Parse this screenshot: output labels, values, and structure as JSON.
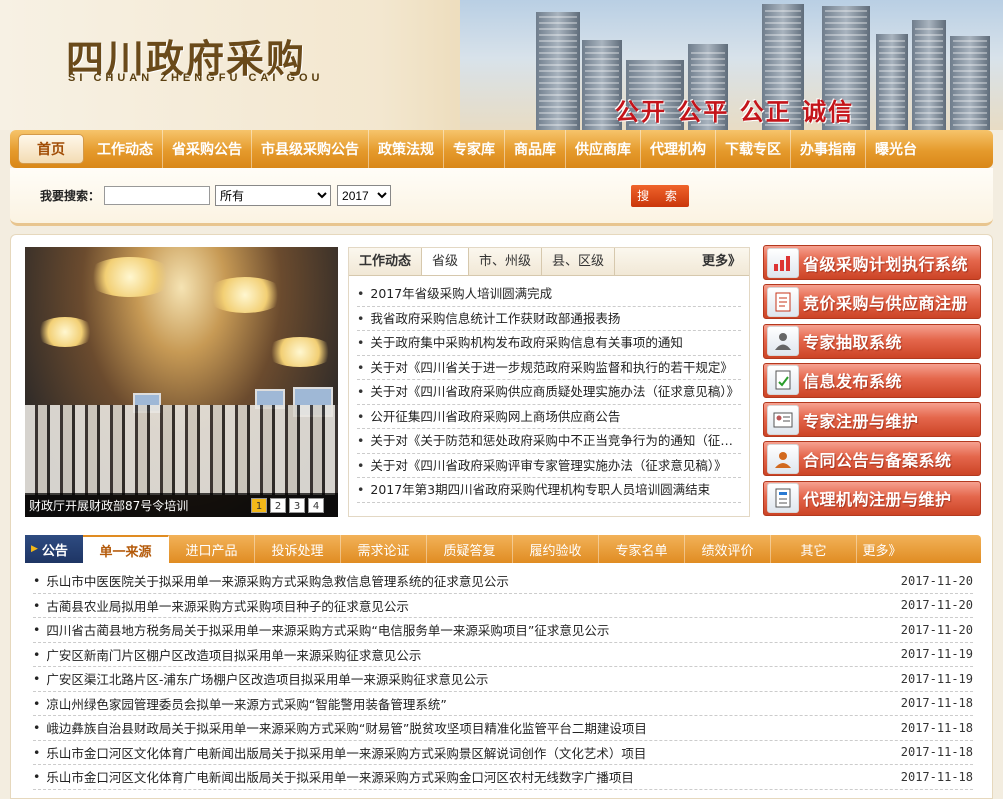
{
  "header": {
    "title_cn": "四川政府采购",
    "title_en": "SI CHUAN ZHENGFU CAI GOU",
    "slogan": "公开 公平 公正 诚信"
  },
  "nav": {
    "items": [
      "首页",
      "工作动态",
      "省采购公告",
      "市县级采购公告",
      "政策法规",
      "专家库",
      "商品库",
      "供应商库",
      "代理机构",
      "下载专区",
      "办事指南",
      "曝光台"
    ]
  },
  "search": {
    "label": "我要搜索：",
    "keyword_value": "",
    "category_selected": "所有",
    "year_selected": "2017",
    "button_label": "搜 索"
  },
  "slideshow": {
    "caption": "财政厅开展财政部87号令培训",
    "pages": [
      "1",
      "2",
      "3",
      "4"
    ],
    "active_page": "1"
  },
  "news": {
    "title": "工作动态",
    "tabs": [
      "省级",
      "市、州级",
      "县、区级"
    ],
    "more": "更多》",
    "items": [
      "2017年省级采购人培训圆满完成",
      "我省政府采购信息统计工作获财政部通报表扬",
      "关于政府集中采购机构发布政府采购信息有关事项的通知",
      "关于对《四川省关于进一步规范政府采购监督和执行的若干规定》",
      "关于对《四川省政府采购供应商质疑处理实施办法（征求意见稿）》",
      "公开征集四川省政府采购网上商场供应商公告",
      "关于对《关于防范和惩处政府采购中不正当竞争行为的通知（征求意见稿）》",
      "关于对《四川省政府采购评审专家管理实施办法（征求意见稿）》",
      "2017年第3期四川省政府采购代理机构专职人员培训圆满结束"
    ]
  },
  "systems": {
    "items": [
      {
        "label": "省级采购计划执行系统",
        "icon": "chart-icon"
      },
      {
        "label": "竞价采购与供应商注册",
        "icon": "document-icon"
      },
      {
        "label": "专家抽取系统",
        "icon": "person-icon"
      },
      {
        "label": "信息发布系统",
        "icon": "checklist-icon"
      },
      {
        "label": "专家注册与维护",
        "icon": "id-card-icon"
      },
      {
        "label": "合同公告与备案系统",
        "icon": "people-icon"
      },
      {
        "label": "代理机构注册与维护",
        "icon": "form-icon"
      }
    ]
  },
  "announcements": {
    "label": "公告",
    "tabs": [
      "单一来源",
      "进口产品",
      "投诉处理",
      "需求论证",
      "质疑答复",
      "履约验收",
      "专家名单",
      "绩效评价",
      "其它"
    ],
    "active_tab": "单一来源",
    "more": "更多》",
    "items": [
      {
        "title": "乐山市中医医院关于拟采用单一来源采购方式采购急救信息管理系统的征求意见公示",
        "date": "2017-11-20"
      },
      {
        "title": "古蔺县农业局拟用单一来源采购方式采购项目种子的征求意见公示",
        "date": "2017-11-20"
      },
      {
        "title": "四川省古蔺县地方税务局关于拟采用单一来源采购方式采购“电信服务单一来源采购项目”征求意见公示",
        "date": "2017-11-20"
      },
      {
        "title": "广安区新南门片区棚户区改造项目拟采用单一来源采购征求意见公示",
        "date": "2017-11-19"
      },
      {
        "title": "广安区渠江北路片区-浦东广场棚户区改造项目拟采用单一来源采购征求意见公示",
        "date": "2017-11-19"
      },
      {
        "title": "凉山州绿色家园管理委员会拟单一来源方式采购“智能警用装备管理系统”",
        "date": "2017-11-18"
      },
      {
        "title": "峨边彝族自治县财政局关于拟采用单一来源采购方式采购“财易管”脱贫攻坚项目精准化监管平台二期建设项目",
        "date": "2017-11-18"
      },
      {
        "title": "乐山市金口河区文化体育广电新闻出版局关于拟采用单一来源采购方式采购景区解说词创作（文化艺术）项目",
        "date": "2017-11-18"
      },
      {
        "title": "乐山市金口河区文化体育广电新闻出版局关于拟采用单一来源采购方式采购金口河区农村无线数字广播项目",
        "date": "2017-11-18"
      }
    ]
  }
}
